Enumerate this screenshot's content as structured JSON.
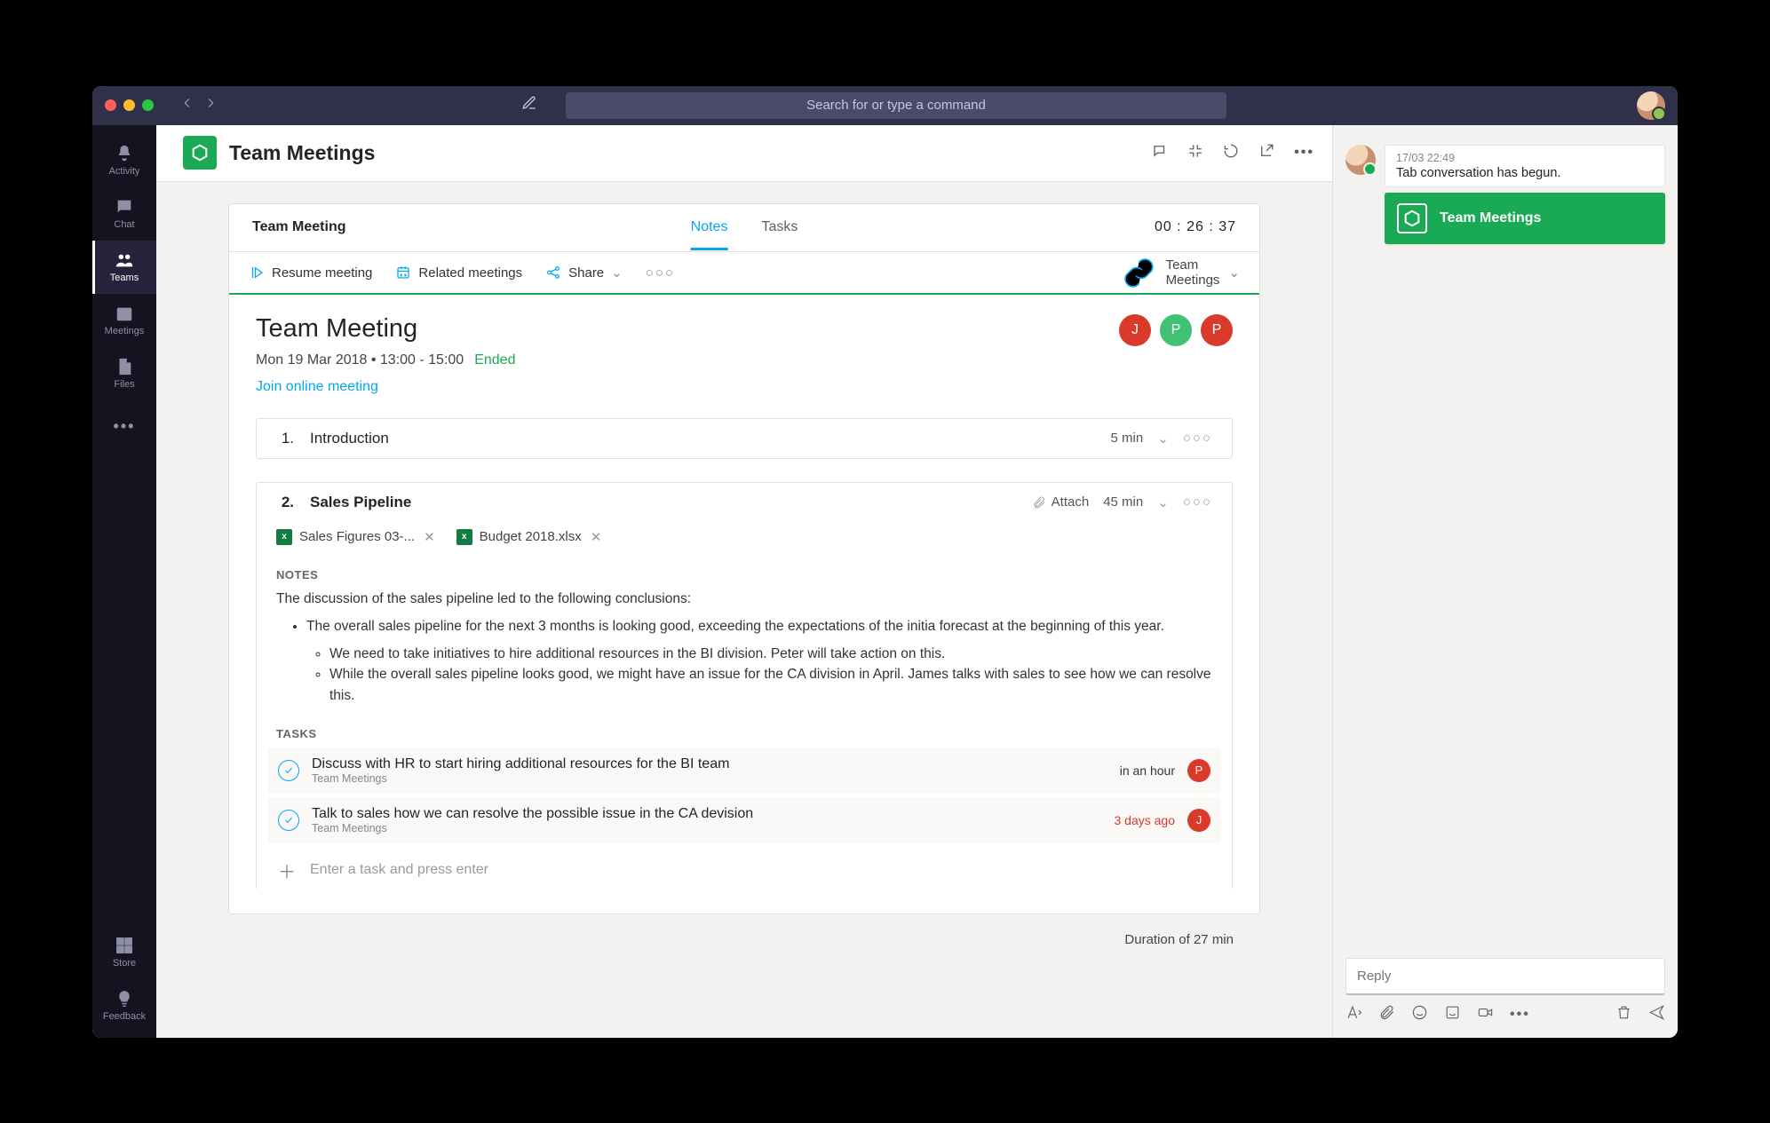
{
  "titlebar": {
    "search_placeholder": "Search for or type a command"
  },
  "rail": {
    "items": [
      {
        "label": "Activity"
      },
      {
        "label": "Chat"
      },
      {
        "label": "Teams"
      },
      {
        "label": "Meetings"
      },
      {
        "label": "Files"
      },
      {
        "label": "…"
      }
    ],
    "store": "Store",
    "feedback": "Feedback"
  },
  "channel": {
    "title": "Team Meetings"
  },
  "meeting": {
    "tab_title": "Team Meeting",
    "tabs": {
      "notes": "Notes",
      "tasks": "Tasks"
    },
    "timer": "00 : 26 : 37",
    "toolbar": {
      "resume": "Resume meeting",
      "related": "Related meetings",
      "share": "Share",
      "breadcrumb": "Team Meetings"
    },
    "header": {
      "title": "Team Meeting",
      "date": "Mon 19 Mar 2018 • 13:00 - 15:00",
      "status": "Ended",
      "join": "Join online meeting",
      "attendees": [
        {
          "initial": "J",
          "color": "red"
        },
        {
          "initial": "P",
          "color": "green"
        },
        {
          "initial": "P",
          "color": "red"
        }
      ]
    },
    "agenda": [
      {
        "num": "1.",
        "title": "Introduction",
        "duration": "5 min"
      },
      {
        "num": "2.",
        "title": "Sales Pipeline",
        "attach_label": "Attach",
        "duration": "45 min",
        "files": [
          {
            "name": "Sales Figures 03-..."
          },
          {
            "name": "Budget 2018.xlsx"
          }
        ],
        "notes_label": "NOTES",
        "notes_intro": "The discussion of the sales pipeline led to the following conclusions:",
        "notes_bullets": [
          "The overall sales pipeline for the next 3 months is looking good, exceeding the expectations of the initia forecast at the beginning of this year."
        ],
        "notes_subbullets": [
          "We need to take initiatives to hire additional resources in the BI division. Peter will take action on this.",
          "While the overall sales pipeline looks good, we might have an issue for the CA division in April. James talks with sales to see how we can resolve this."
        ],
        "tasks_label": "TASKS",
        "tasks": [
          {
            "title": "Discuss with HR to start hiring additional resources for the BI team",
            "project": "Team Meetings",
            "due": "in an hour",
            "due_class": "soon",
            "assignee": "P",
            "av_color": "red"
          },
          {
            "title": "Talk to sales how we can resolve the possible issue in the CA devision",
            "project": "Team Meetings",
            "due": "3 days ago",
            "due_class": "late",
            "assignee": "J",
            "av_color": "red"
          }
        ],
        "add_task_placeholder": "Enter a task and press enter"
      }
    ],
    "footer": "Duration of 27 min"
  },
  "conversation": {
    "msg_time": "17/03 22:49",
    "msg_text": "Tab conversation has begun.",
    "card_title": "Team Meetings",
    "reply_placeholder": "Reply"
  }
}
